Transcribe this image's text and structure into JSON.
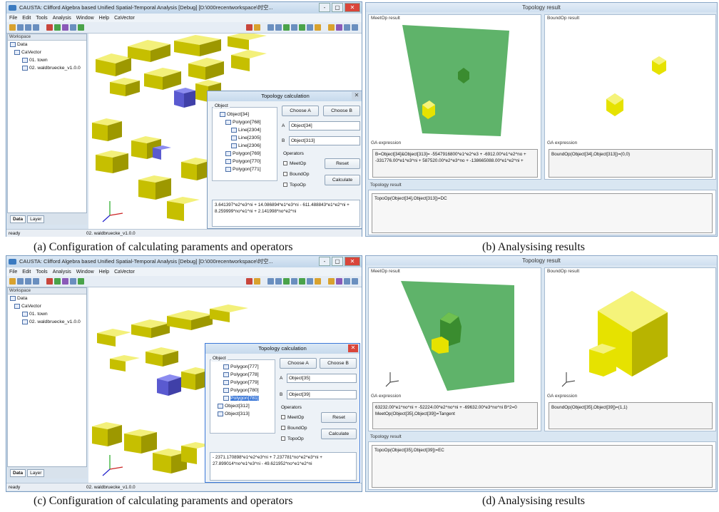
{
  "app": {
    "title": "CAUSTA: Clifford Algebra based Unified Spatial-Temporal Analysis [Debug] [D:\\000recentworkspace\\时空...",
    "window_buttons": [
      "-",
      "▢",
      "✕"
    ],
    "menus": [
      "File",
      "Edit",
      "Tools",
      "Analysis",
      "Window",
      "Help",
      "CaVector"
    ],
    "workspace_header": "Workspace",
    "tree": {
      "root": "Data",
      "group": "CaVector",
      "items": [
        "01. town",
        "02. waldbruecke_v1.0.0"
      ]
    },
    "tabs": [
      "Data",
      "Layer"
    ],
    "status_left": "ready",
    "status_layer": "02. waldbruecke_v1.0.0"
  },
  "dialog": {
    "title": "Topology calculation",
    "close": "✕",
    "object_group_label": "Object",
    "choose_a": "Choose A",
    "choose_b": "Choose B",
    "label_a": "A",
    "label_b": "B",
    "operators_label": "Operators",
    "ops": [
      "MeetOp",
      "BoundOp",
      "TopoOp"
    ],
    "reset": "Reset",
    "calculate": "Calculate"
  },
  "panel_a": {
    "tree": [
      "Object[34]",
      "Polygon[768]",
      "Line[2304]",
      "Line[2305]",
      "Line[2306]",
      "Polygon[769]",
      "Polygon[770]",
      "Polygon[771]"
    ],
    "field_a": "Object[34]",
    "field_b": "Object[313]",
    "output": "3.641397*e2^e3^ni + 14.086894*e1^e3^ni - 611.488843*e1^e2^ni + 8.259999*no^e1^ni + 2.141998*no^e2^ni"
  },
  "panel_c": {
    "tree": [
      "Polygon[777]",
      "Polygon[778]",
      "Polygon[779]",
      "Polygon[780]",
      "Polygon[781]",
      "Object[312]",
      "Object[313]"
    ],
    "field_a": "Object[35]",
    "field_b": "Object[39]",
    "output": "- 2371.170898*e1^e2^e3^ni + 7.237781*no^e2^e3^ni + 27.899014*no^e1^e3^ni - 49.621952*no^e1^e2^ni"
  },
  "result_common": {
    "title": "Topology result",
    "meet_pane": "MeetOp result",
    "bound_pane": "BoundOp result",
    "ga_label": "GA expression",
    "topo_label": "Topology result"
  },
  "panel_b": {
    "meet_ga": "B=Object[34]&Object[313]= -5547916800*e1^e2^e3 + -6912.00*e1^e2^no + -331776.00*e1^e3^ni + 587520.00*e2^e3^no + -138665088.00*e1^e2^ni +",
    "bound_ga": "BoundOp(Object[34],Object[313])=(0,0)",
    "topo": "TopoOp(Object[34],Object[313])=DC"
  },
  "panel_d": {
    "meet_ga": "63232.00*e1^no^ni + -52224.00*e2^no^ni + -69632.00*e3^no^ni B^2=0 MeetOp(Object[35],Object[39])=Tangent",
    "bound_ga": "BoundOp(Object[35],Object[39])=(1,1)",
    "topo": "TopoOp(Object[35],Object[39])=EC"
  },
  "captions": {
    "a": "(a) Configuration of calculating paraments and operators",
    "b": "(b) Analysising results",
    "c": "(c) Configuration of calculating paraments and operators",
    "d": "(d) Analysising results"
  },
  "colors": {
    "accent": "#3b78d8",
    "green_plane": "#5fb36a",
    "yellow_block": "#e6e200",
    "frame_blue": "#8aa7c7"
  }
}
